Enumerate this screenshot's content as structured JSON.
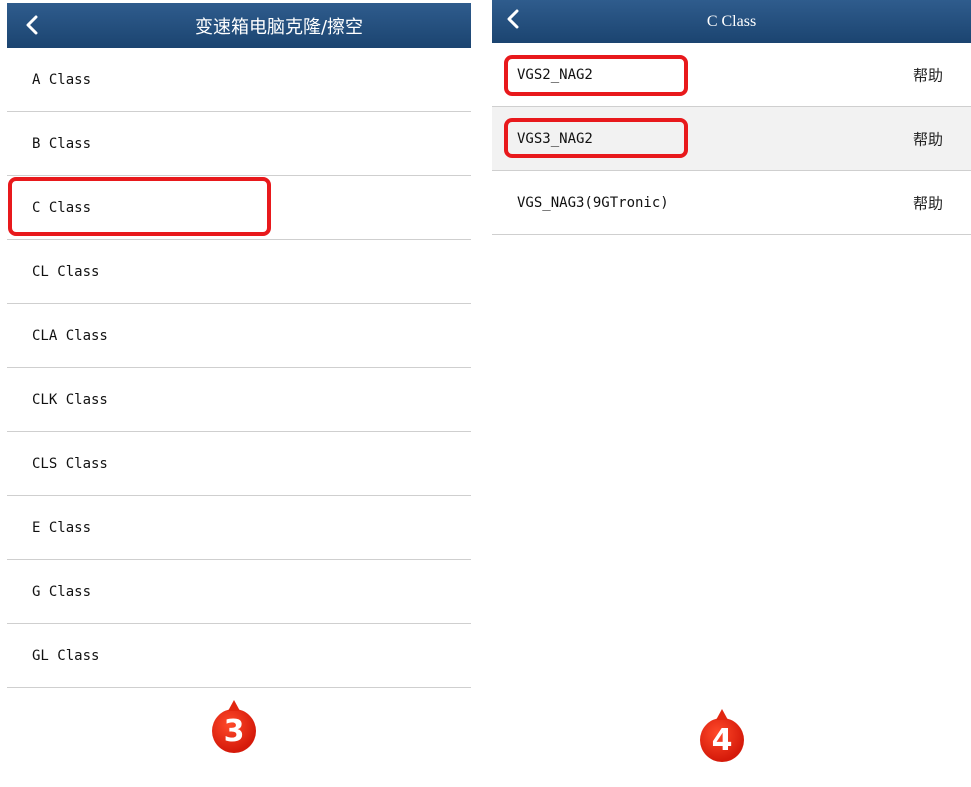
{
  "left": {
    "title": "变速箱电脑克隆/擦空",
    "items": [
      "A Class",
      "B Class",
      "C Class",
      "CL Class",
      "CLA Class",
      "CLK Class",
      "CLS Class",
      "E Class",
      "G Class",
      "GL Class"
    ],
    "step_badge": "3"
  },
  "right": {
    "title": "C Class",
    "items": [
      {
        "label": "VGS2_NAG2",
        "help": "帮助"
      },
      {
        "label": "VGS3_NAG2",
        "help": "帮助"
      },
      {
        "label": "VGS_NAG3(9GTronic)",
        "help": "帮助"
      }
    ],
    "step_badge": "4"
  },
  "colors": {
    "header": "#1f4a78",
    "highlight": "#e8191c",
    "badge": "#e2260f"
  }
}
